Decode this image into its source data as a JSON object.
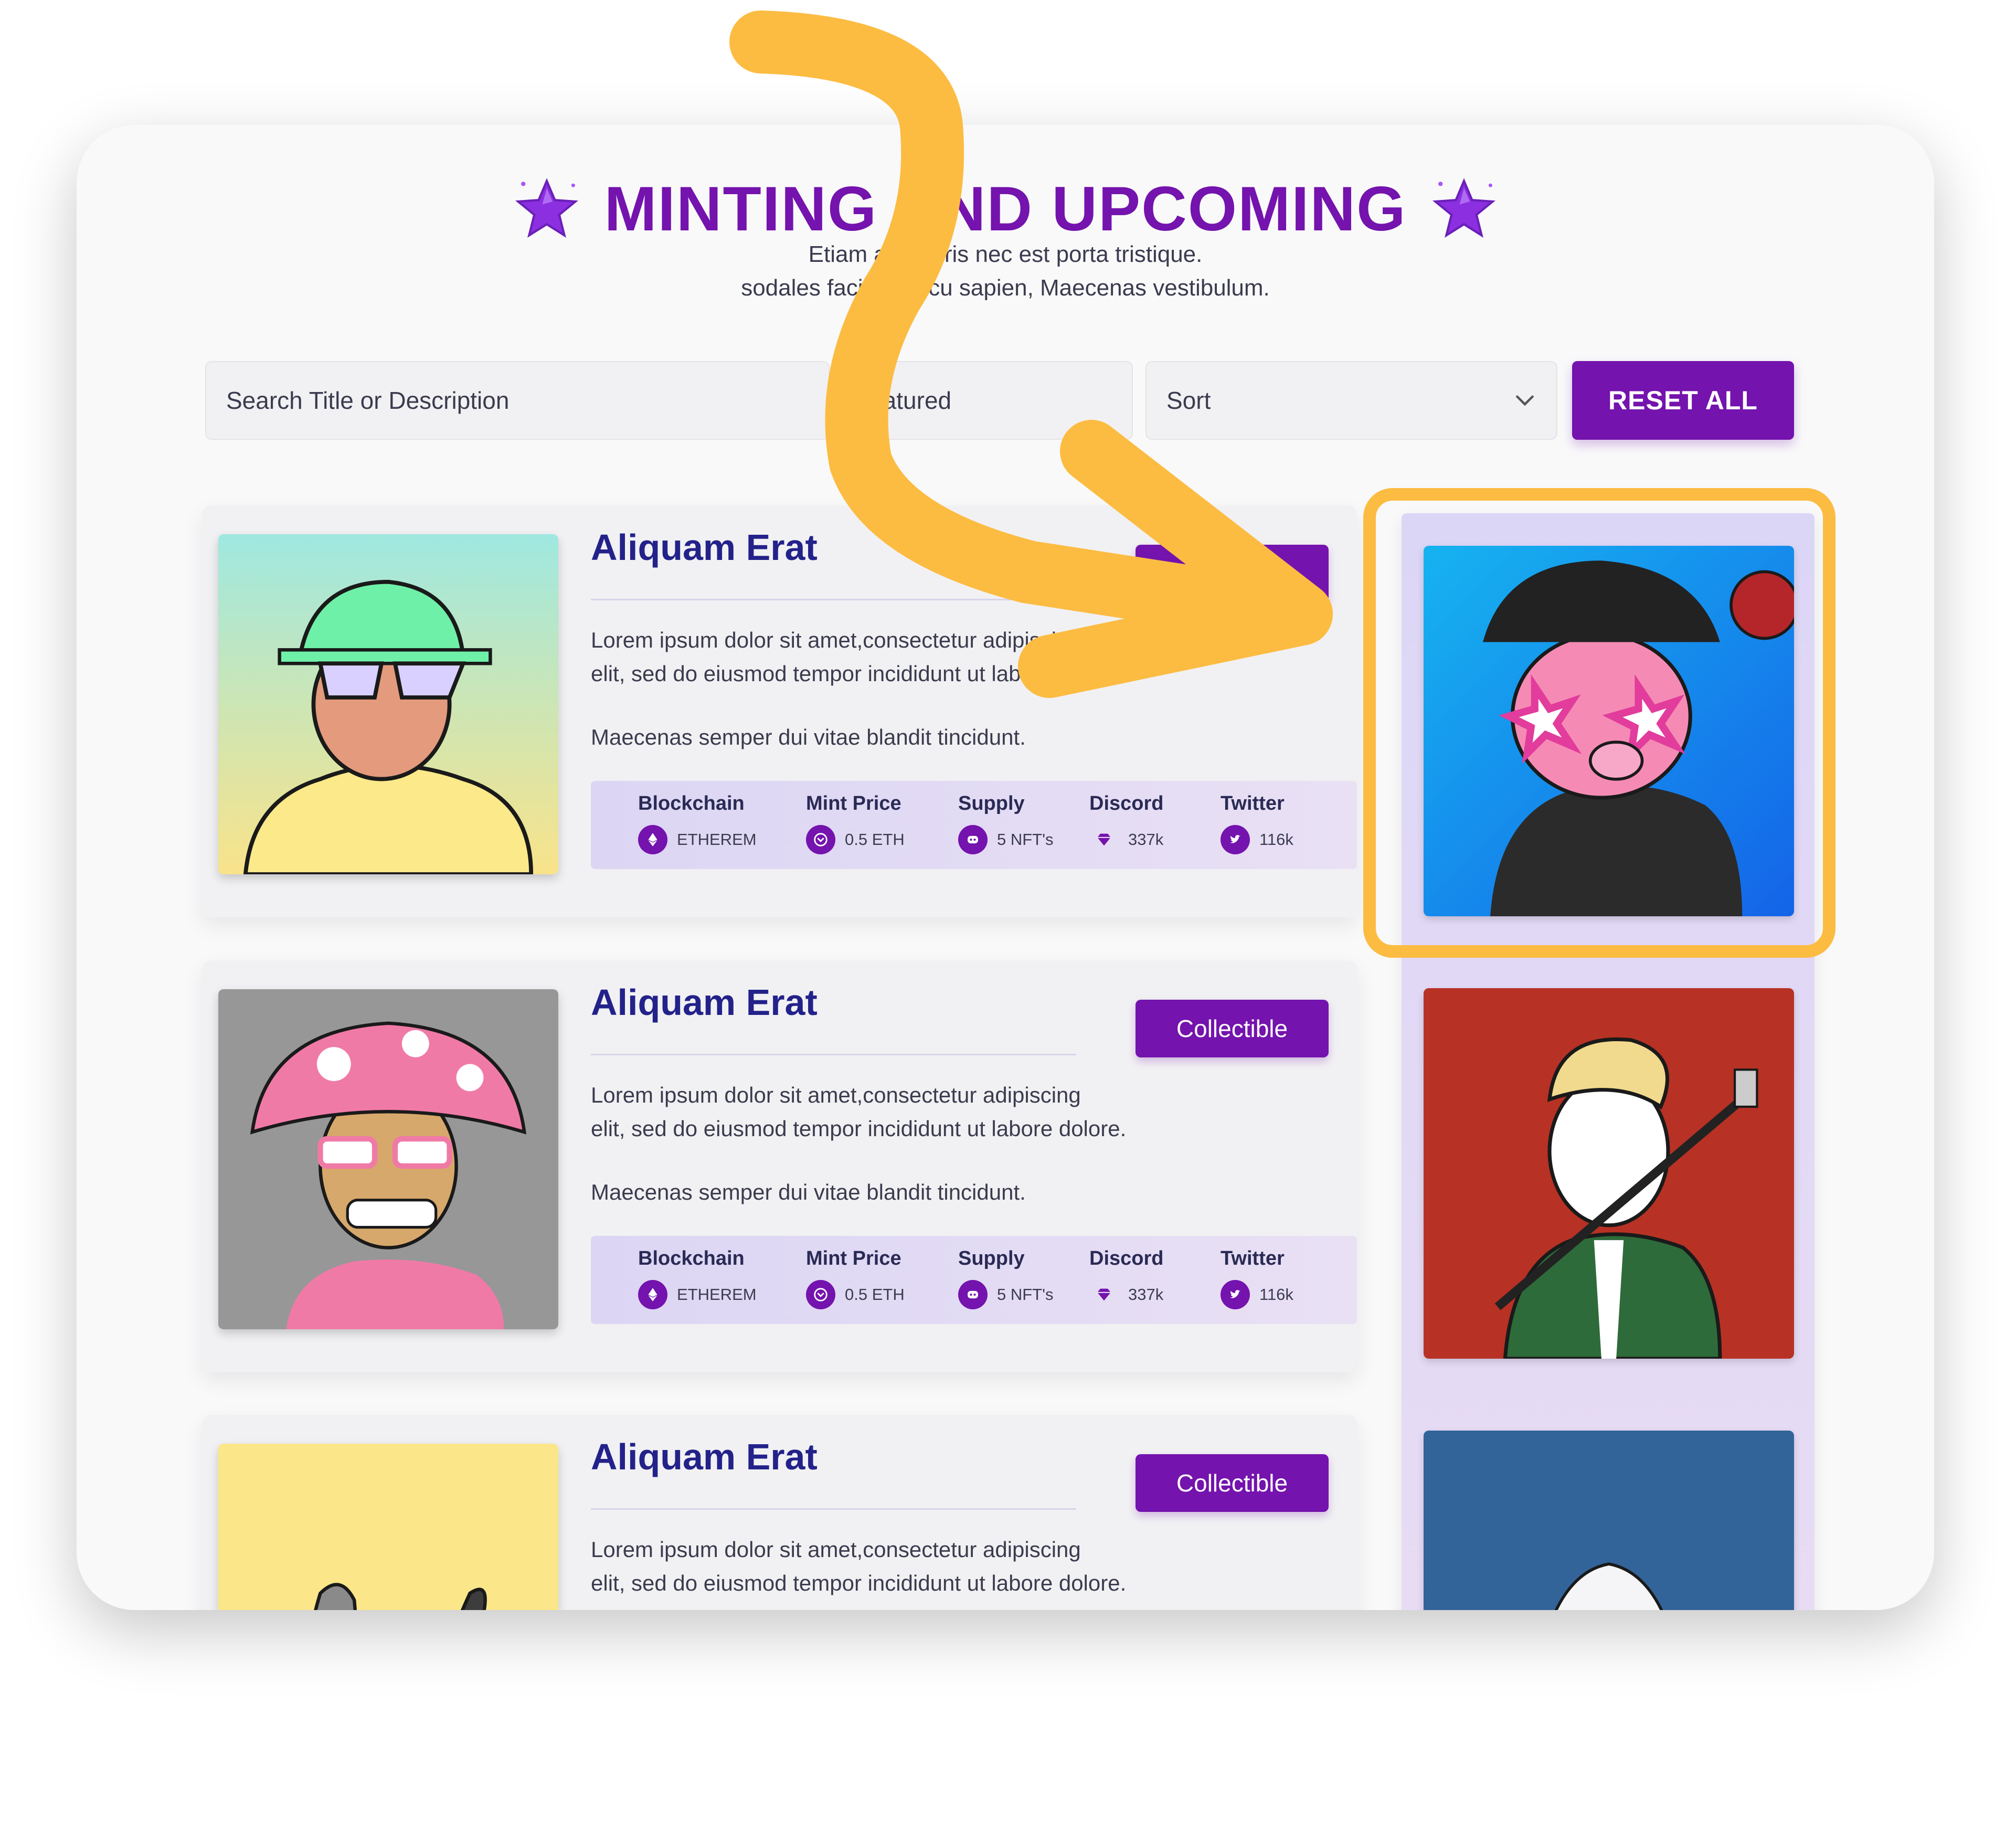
{
  "header": {
    "title": "MINTING AND UPCOMING",
    "subtitle_line1": "Etiam at mauris nec est porta tristique.",
    "subtitle_line2": "sodales facilisis arcu sapien, Maecenas vestibulum."
  },
  "filters": {
    "search_placeholder": "Search Title or Description",
    "featured_label": "Featured",
    "sort_label": "Sort",
    "reset_label": "RESET ALL"
  },
  "cards": [
    {
      "title": "Aliquam Erat",
      "tag": "Collectible",
      "desc_line1": "Lorem ipsum dolor sit amet,consectetur adipiscing",
      "desc_line2": "elit, sed do eiusmod tempor incididunt ut labore dolore.",
      "desc_line3": "Maecenas semper dui vitae blandit tincidunt.",
      "stats": [
        {
          "label": "Blockchain",
          "value": "ETHEREM",
          "icon": "ethereum-icon"
        },
        {
          "label": "Mint Price",
          "value": "0.5 ETH",
          "icon": "coin-icon"
        },
        {
          "label": "Supply",
          "value": "5 NFT's",
          "icon": "discord-icon"
        },
        {
          "label": "Discord",
          "value": "337k",
          "icon": "diamond-icon"
        },
        {
          "label": "Twitter",
          "value": "116k",
          "icon": "twitter-icon"
        }
      ]
    },
    {
      "title": "Aliquam Erat",
      "tag": "Collectible",
      "desc_line1": "Lorem ipsum dolor sit amet,consectetur adipiscing",
      "desc_line2": "elit, sed do eiusmod tempor incididunt ut labore dolore.",
      "desc_line3": "Maecenas semper dui vitae blandit tincidunt.",
      "stats": [
        {
          "label": "Blockchain",
          "value": "ETHEREM",
          "icon": "ethereum-icon"
        },
        {
          "label": "Mint Price",
          "value": "0.5 ETH",
          "icon": "coin-icon"
        },
        {
          "label": "Supply",
          "value": "5 NFT's",
          "icon": "discord-icon"
        },
        {
          "label": "Discord",
          "value": "337k",
          "icon": "diamond-icon"
        },
        {
          "label": "Twitter",
          "value": "116k",
          "icon": "twitter-icon"
        }
      ]
    },
    {
      "title": "Aliquam Erat",
      "tag": "Collectible",
      "desc_line1": "Lorem ipsum dolor sit amet,consectetur adipiscing",
      "desc_line2": "elit, sed do eiusmod tempor incididunt ut labore dolore."
    }
  ],
  "colors": {
    "accent": "#7413ad",
    "title_blue": "#23228a",
    "highlight": "#fcbc42"
  }
}
